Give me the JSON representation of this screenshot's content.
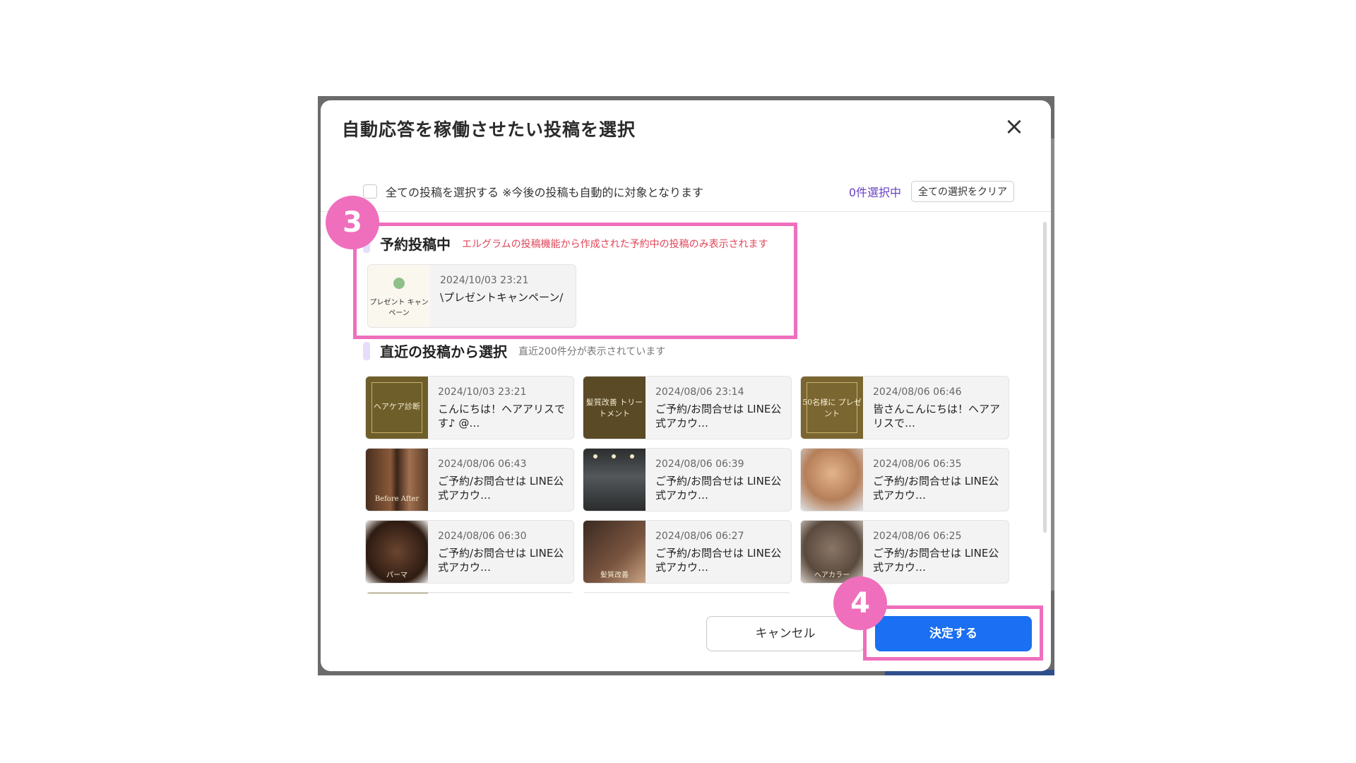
{
  "dialog": {
    "title": "自動応答を稼働させたい投稿を選択",
    "close_icon": "×"
  },
  "select_all": {
    "label": "全ての投稿を選択する ※今後の投稿も自動的に対象となります",
    "selected_count": "0件選択中",
    "clear_button": "全ての選択をクリア"
  },
  "scheduled": {
    "title": "予約投稿中",
    "note": "エルグラムの投稿機能から作成された予約中の投稿のみ表示されます",
    "posts": [
      {
        "date": "2024/10/03 23:21",
        "caption": "\\プレゼントキャンペーン/",
        "thumb_text": "プレゼント キャンペーン"
      }
    ]
  },
  "recent": {
    "title": "直近の投稿から選択",
    "note": "直近200件分が表示されています",
    "posts": [
      {
        "date": "2024/10/03 23:21",
        "caption": "こんにちは！ヘアアリスです♪ @…",
        "thumb_text": "ヘアケア診断"
      },
      {
        "date": "2024/08/06 23:14",
        "caption": "ご予約/お問合せは LINE公式アカウ…",
        "thumb_text": "髪質改善 トリートメント"
      },
      {
        "date": "2024/08/06 06:46",
        "caption": "皆さんこんにちは！ヘアアリスで…",
        "thumb_text": "50名様に プレゼント"
      },
      {
        "date": "2024/08/06 06:43",
        "caption": "ご予約/お問合せは LINE公式アカウ…",
        "thumb_text": "Before After"
      },
      {
        "date": "2024/08/06 06:39",
        "caption": "ご予約/お問合せは LINE公式アカウ…",
        "thumb_text": ""
      },
      {
        "date": "2024/08/06 06:35",
        "caption": "ご予約/お問合せは LINE公式アカウ…",
        "thumb_text": ""
      },
      {
        "date": "2024/08/06 06:30",
        "caption": "ご予約/お問合せは LINE公式アカウ…",
        "thumb_text": "パーマ"
      },
      {
        "date": "2024/08/06 06:27",
        "caption": "ご予約/お問合せは LINE公式アカウ…",
        "thumb_text": "髪質改善"
      },
      {
        "date": "2024/08/06 06:25",
        "caption": "ご予約/お問合せは LINE公式アカウ…",
        "thumb_text": "ヘアカラー"
      }
    ]
  },
  "footer": {
    "cancel_button": "キャンセル",
    "confirm_button": "決定する"
  },
  "annotations": {
    "step3": "3",
    "step4": "4"
  },
  "colors": {
    "annotation": "#ef6fbd",
    "primary": "#1a6ff2",
    "count_text": "#6a3fc6",
    "note_red": "#e0465a"
  }
}
